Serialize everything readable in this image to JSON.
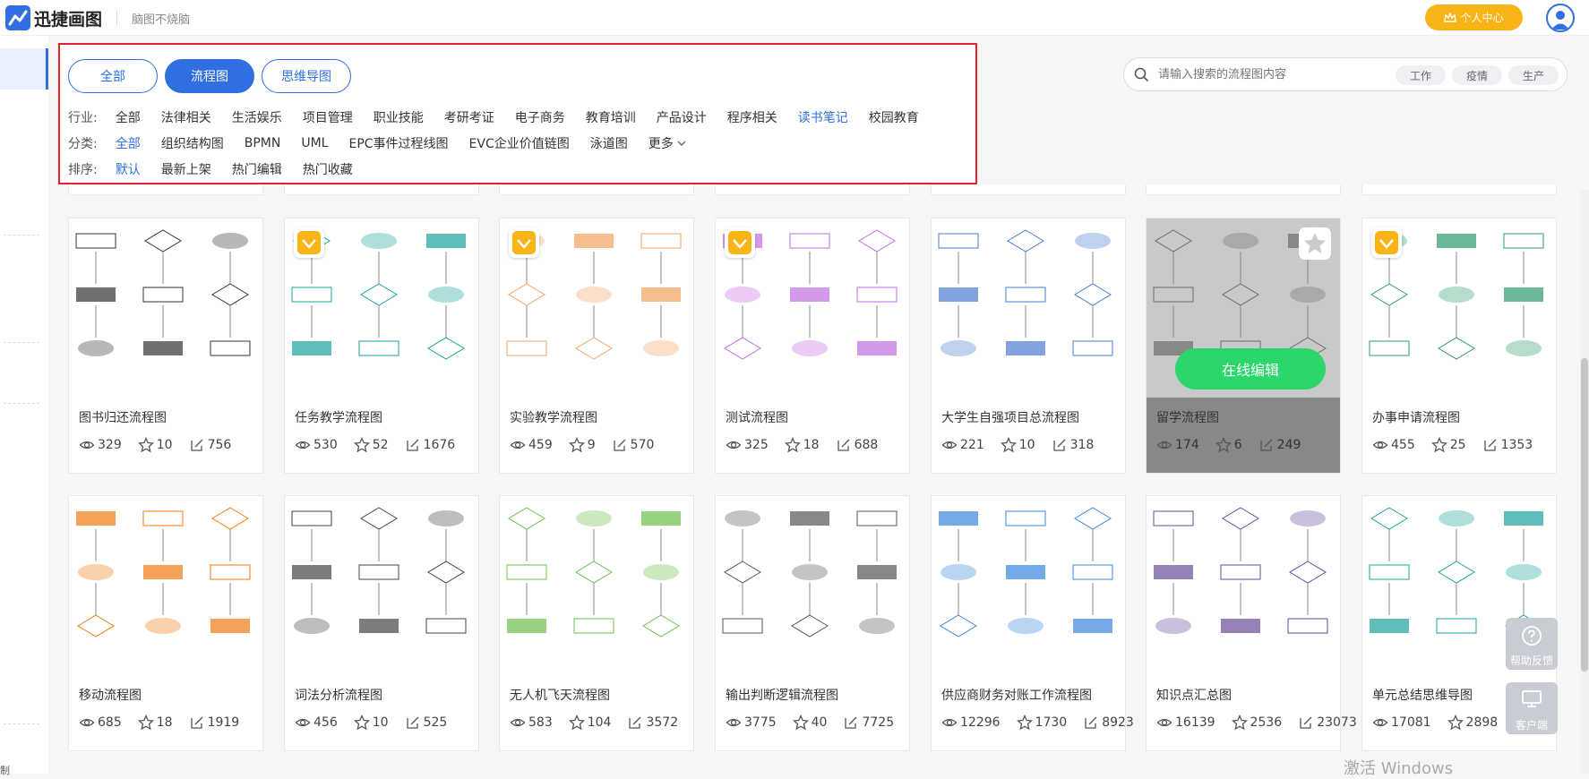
{
  "header": {
    "brand": "迅捷画图",
    "slogan": "脑图不烧脑",
    "vip_label": "个人中心"
  },
  "sidebar": {
    "bottom_text": "制"
  },
  "tabs": [
    {
      "label": "全部",
      "active": false
    },
    {
      "label": "流程图",
      "active": true
    },
    {
      "label": "思维导图",
      "active": false
    }
  ],
  "filters": {
    "industry": {
      "label": "行业:",
      "options": [
        "全部",
        "法律相关",
        "生活娱乐",
        "项目管理",
        "职业技能",
        "考研考证",
        "电子商务",
        "教育培训",
        "产品设计",
        "程序相关",
        "读书笔记",
        "校园教育"
      ],
      "selected": "读书笔记"
    },
    "category": {
      "label": "分类:",
      "options": [
        "全部",
        "组织结构图",
        "BPMN",
        "UML",
        "EPC事件过程线图",
        "EVC企业价值链图",
        "泳道图",
        "更多"
      ],
      "selected": "全部"
    },
    "sort": {
      "label": "排序:",
      "options": [
        "默认",
        "最新上架",
        "热门编辑",
        "热门收藏"
      ],
      "selected": "默认"
    }
  },
  "search": {
    "placeholder": "请输入搜索的流程图内容",
    "chips": [
      "工作",
      "疫情",
      "生产"
    ]
  },
  "hover_action": "在线编辑",
  "cards": [
    {
      "title": "图书归还流程图",
      "views": "329",
      "stars": "10",
      "edits": "756",
      "vip": false
    },
    {
      "title": "任务教学流程图",
      "views": "530",
      "stars": "52",
      "edits": "1676",
      "vip": true
    },
    {
      "title": "实验教学流程图",
      "views": "459",
      "stars": "9",
      "edits": "570",
      "vip": true
    },
    {
      "title": "测试流程图",
      "views": "325",
      "stars": "18",
      "edits": "688",
      "vip": true
    },
    {
      "title": "大学生自强项目总流程图",
      "views": "221",
      "stars": "10",
      "edits": "318",
      "vip": false
    },
    {
      "title": "留学流程图",
      "views": "174",
      "stars": "6",
      "edits": "249",
      "vip": false
    },
    {
      "title": "办事申请流程图",
      "views": "455",
      "stars": "25",
      "edits": "1353",
      "vip": true
    },
    {
      "title": "移动流程图",
      "views": "685",
      "stars": "18",
      "edits": "1919",
      "vip": false
    },
    {
      "title": "词法分析流程图",
      "views": "456",
      "stars": "10",
      "edits": "525",
      "vip": false
    },
    {
      "title": "无人机飞天流程图",
      "views": "583",
      "stars": "104",
      "edits": "3572",
      "vip": false
    },
    {
      "title": "输出判断逻辑流程图",
      "views": "3775",
      "stars": "40",
      "edits": "7725",
      "vip": false
    },
    {
      "title": "供应商财务对账工作流程图",
      "views": "12296",
      "stars": "1730",
      "edits": "8923",
      "vip": false
    },
    {
      "title": "知识点汇总图",
      "views": "16139",
      "stars": "2536",
      "edits": "23073",
      "vip": false
    },
    {
      "title": "单元总结思维导图",
      "views": "17081",
      "stars": "2898",
      "edits": "",
      "vip": false
    }
  ],
  "float": {
    "help": "帮助反馈",
    "client": "客户端"
  },
  "watermark": "激活 Windows",
  "colors": {
    "accent": "#2f6fe0",
    "highlight": "#e5212b",
    "vip": "#f9b417",
    "edit": "#2bd76b"
  }
}
